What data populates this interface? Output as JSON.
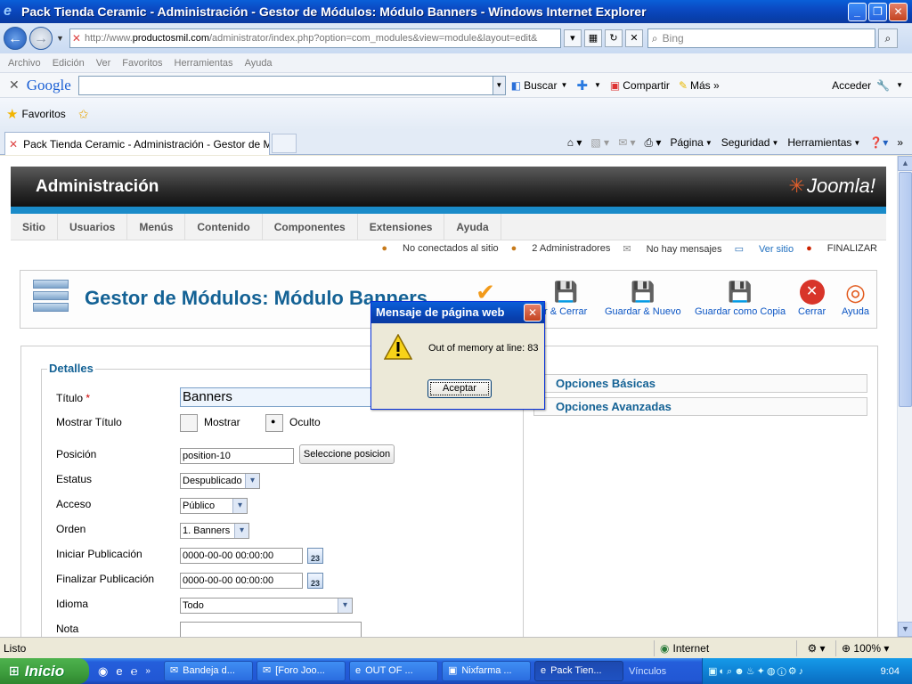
{
  "window": {
    "title": "Pack Tienda Ceramic - Administración - Gestor de Módulos: Módulo Banners - Windows Internet Explorer"
  },
  "address": {
    "url_prefix": "http://www.",
    "url_domain": "productosmil.com",
    "url_rest": "/administrator/index.php?option=com_modules&view=module&layout=edit&",
    "search_placeholder": "Bing"
  },
  "menubar": [
    "Archivo",
    "Edición",
    "Ver",
    "Favoritos",
    "Herramientas",
    "Ayuda"
  ],
  "googlebar": {
    "logo": "Google",
    "buttons": [
      "Buscar",
      "Compartir",
      "Más »"
    ],
    "signin": "Acceder"
  },
  "favbar": {
    "label": "Favoritos"
  },
  "tab": {
    "label": "Pack Tienda Ceramic - Administración - Gestor de Mód..."
  },
  "commandbar": [
    "Página",
    "Seguridad",
    "Herramientas"
  ],
  "joomla": {
    "header_title": "Administración",
    "logo_text": "Joomla!",
    "menu": [
      "Sitio",
      "Usuarios",
      "Menús",
      "Contenido",
      "Componentes",
      "Extensiones",
      "Ayuda"
    ],
    "status": {
      "not_connected": "No conectados al sitio",
      "admins": "2 Administradores",
      "messages": "No hay mensajes",
      "view_site": "Ver sitio",
      "logout": "FINALIZAR"
    },
    "page_title": "Gestor de Módulos: Módulo Banners",
    "toolbar": {
      "save_close": "r & Cerrar",
      "save_new": "Guardar & Nuevo",
      "save_copy": "Guardar como Copia",
      "close": "Cerrar",
      "help": "Ayuda"
    },
    "details": {
      "legend": "Detalles",
      "title_label": "Título",
      "title_req": "*",
      "title_value": "Banners",
      "show_title_label": "Mostrar Título",
      "show_option": "Mostrar",
      "hide_option": "Oculto",
      "position_label": "Posición",
      "position_value": "position-10",
      "select_position_button": "Seleccione posicion",
      "status_label": "Estatus",
      "status_value": "Despublicado",
      "access_label": "Acceso",
      "access_value": "Público",
      "order_label": "Orden",
      "order_value": "1. Banners",
      "start_label": "Iniciar Publicación",
      "start_value": "0000-00-00 00:00:00",
      "finish_label": "Finalizar Publicación",
      "finish_value": "0000-00-00 00:00:00",
      "cal_glyph": "23",
      "language_label": "Idioma",
      "language_value": "Todo",
      "note_label": "Nota"
    },
    "options": {
      "basic": "Opciones Básicas",
      "advanced": "Opciones Avanzadas"
    }
  },
  "dialog": {
    "title": "Mensaje de página web",
    "message": "Out of memory at line: 83",
    "ok": "Aceptar"
  },
  "statusbar": {
    "text": "Listo",
    "zone": "Internet",
    "zoom": "100%"
  },
  "taskbar": {
    "start": "Inicio",
    "tasks": [
      "Bandeja d...",
      "[Foro Joo...",
      "OUT OF ...",
      "Nixfarma ...",
      "Pack Tien..."
    ],
    "vinculos": "Vínculos",
    "clock": "9:04"
  }
}
